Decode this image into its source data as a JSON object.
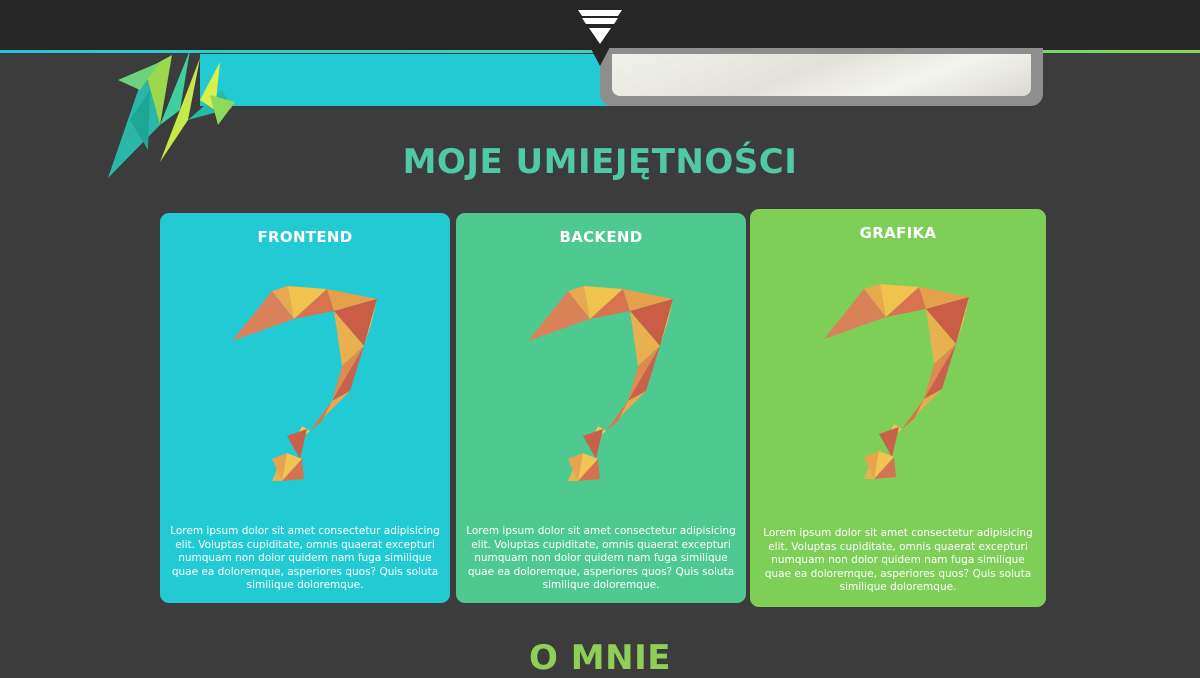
{
  "header": {
    "logo_icon": "diamond-logo-icon"
  },
  "colors": {
    "background": "#3c3c3c",
    "topbar": "#262626",
    "teal": "#22cbd3",
    "green": "#4ec990",
    "lime": "#7ecf58",
    "title_skills": "#4fc9a6",
    "title_about": "#8fcf57"
  },
  "skills": {
    "title": "MOJE UMIEJĘTNOŚCI",
    "cards": [
      {
        "title": "FRONTEND",
        "icon": "question-mark-icon",
        "description": "Lorem ipsum dolor sit amet consectetur adipisicing elit. Voluptas cupiditate, omnis quaerat excepturi numquam non dolor quidem nam fuga similique quae ea doloremque, asperiores quos? Quis soluta similique doloremque."
      },
      {
        "title": "BACKEND",
        "icon": "question-mark-icon",
        "description": "Lorem ipsum dolor sit amet consectetur adipisicing elit. Voluptas cupiditate, omnis quaerat excepturi numquam non dolor quidem nam fuga similique quae ea doloremque, asperiores quos? Quis soluta similique doloremque."
      },
      {
        "title": "GRAFIKA",
        "icon": "question-mark-icon",
        "description": "Lorem ipsum dolor sit amet consectetur adipisicing elit. Voluptas cupiditate, omnis quaerat excepturi numquam non dolor quidem nam fuga similique quae ea doloremque, asperiores quos? Quis soluta similique doloremque."
      }
    ]
  },
  "about": {
    "title": "O MNIE"
  }
}
